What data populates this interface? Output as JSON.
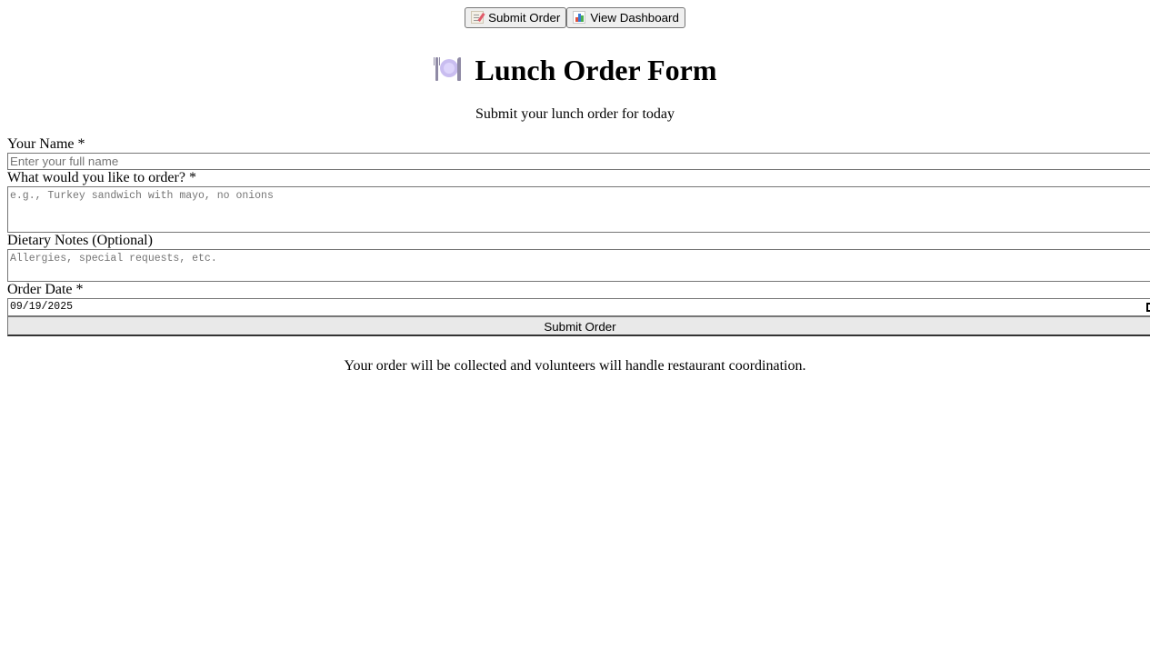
{
  "nav": {
    "submit_order_label": "Submit Order",
    "submit_order_icon": "memo-icon",
    "view_dashboard_label": "View Dashboard",
    "view_dashboard_icon": "bar-chart-icon"
  },
  "header": {
    "title": "Lunch Order Form",
    "title_icon": "fork-knife-plate-icon",
    "subtitle": "Submit your lunch order for today"
  },
  "form": {
    "name": {
      "label": "Your Name *",
      "placeholder": "Enter your full name",
      "value": ""
    },
    "order": {
      "label": "What would you like to order? *",
      "placeholder": "e.g., Turkey sandwich with mayo, no onions",
      "value": ""
    },
    "dietary": {
      "label": "Dietary Notes (Optional)",
      "placeholder": "Allergies, special requests, etc.",
      "value": ""
    },
    "date": {
      "label": "Order Date *",
      "value": "09/19/2025"
    },
    "submit_label": "Submit Order"
  },
  "footer": {
    "note": "Your order will be collected and volunteers will handle restaurant coordination."
  },
  "colors": {
    "button_bg": "#efefef",
    "border": "#767676",
    "placeholder": "#757575",
    "icon_purple": "#c9bdf0"
  }
}
